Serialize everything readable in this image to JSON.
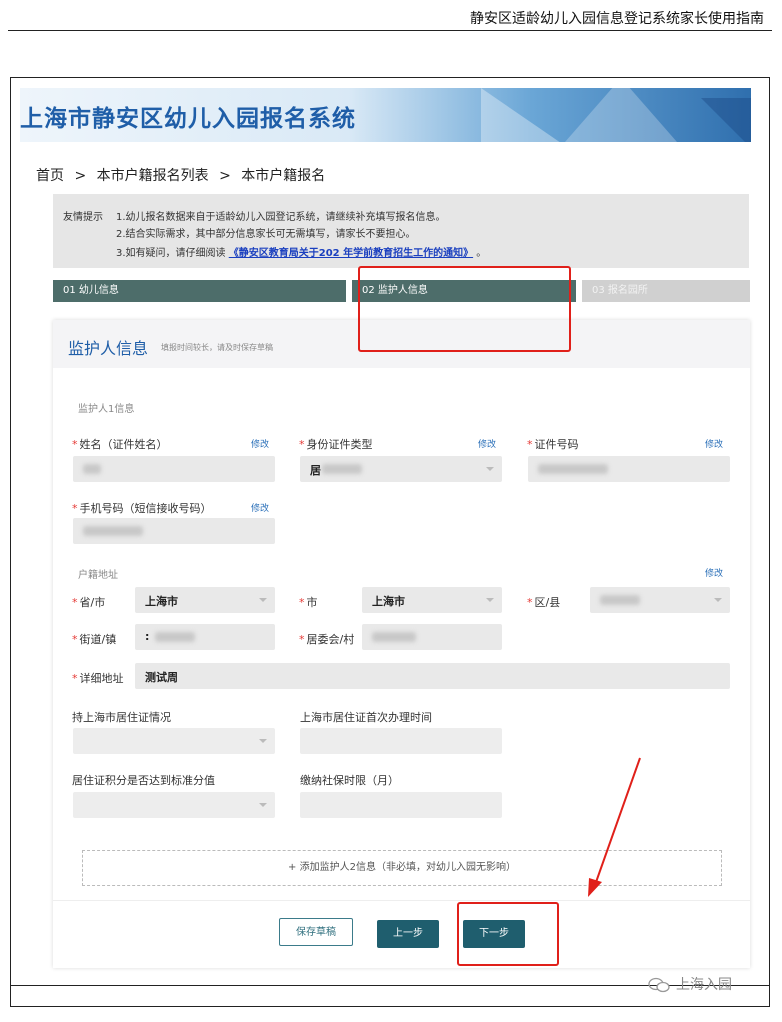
{
  "doc": {
    "header_title": "静安区适龄幼儿入园信息登记系统家长使用指南"
  },
  "banner": {
    "title": "上海市静安区幼儿入园报名系统"
  },
  "breadcrumb": {
    "items": [
      "首页",
      ">",
      "本市户籍报名列表",
      ">",
      "本市户籍报名"
    ]
  },
  "tip": {
    "label": "友情提示",
    "line1": "1.幼儿报名数据来自于适龄幼儿入园登记系统，请继续补充填写报名信息。",
    "line2": "2.结合实际需求，其中部分信息家长可无需填写，请家长不要担心。",
    "line3_prefix": "3.如有疑问，请仔细阅读",
    "line3_link": "《静安区教育局关于202  年学前教育招生工作的通知》",
    "line3_suffix": "。"
  },
  "steps": [
    {
      "label": "01 幼儿信息"
    },
    {
      "label": "02 监护人信息"
    },
    {
      "label": "03 报名园所"
    }
  ],
  "card": {
    "title": "监护人信息",
    "hint": "填报时间较长，请及时保存草稿",
    "section1": "监护人1信息",
    "edit": "修改",
    "fields": {
      "name": {
        "label": "姓名（证件姓名）"
      },
      "id_type": {
        "label": "身份证件类型",
        "value": "居"
      },
      "id_no": {
        "label": "证件号码"
      },
      "phone": {
        "label": "手机号码（短信接收号码）"
      },
      "province": {
        "label": "省/市",
        "value": "上海市"
      },
      "city": {
        "label": "市",
        "value": "上海市"
      },
      "district": {
        "label": "区/县"
      },
      "street": {
        "label": "街道/镇",
        "value": ":"
      },
      "committee": {
        "label": "居委会/村"
      },
      "address": {
        "label": "详细地址",
        "value": "测试周"
      },
      "residence_permit": {
        "label": "持上海市居住证情况"
      },
      "permit_first_time": {
        "label": "上海市居住证首次办理时间"
      },
      "points_standard": {
        "label": "居住证积分是否达到标准分值"
      },
      "social_security": {
        "label": "缴纳社保时限（月）"
      }
    },
    "household_section": "户籍地址",
    "add_guardian": "+ 添加监护人2信息（非必填，对幼儿入园无影响）",
    "buttons": {
      "save": "保存草稿",
      "prev": "上一步",
      "next": "下一步"
    }
  },
  "watermark": {
    "text": "上海入园"
  },
  "colors": {
    "accent": "#1f5ea8",
    "step_active": "#4d6d6a",
    "button": "#1f5e6e",
    "highlight": "#e0201a"
  }
}
